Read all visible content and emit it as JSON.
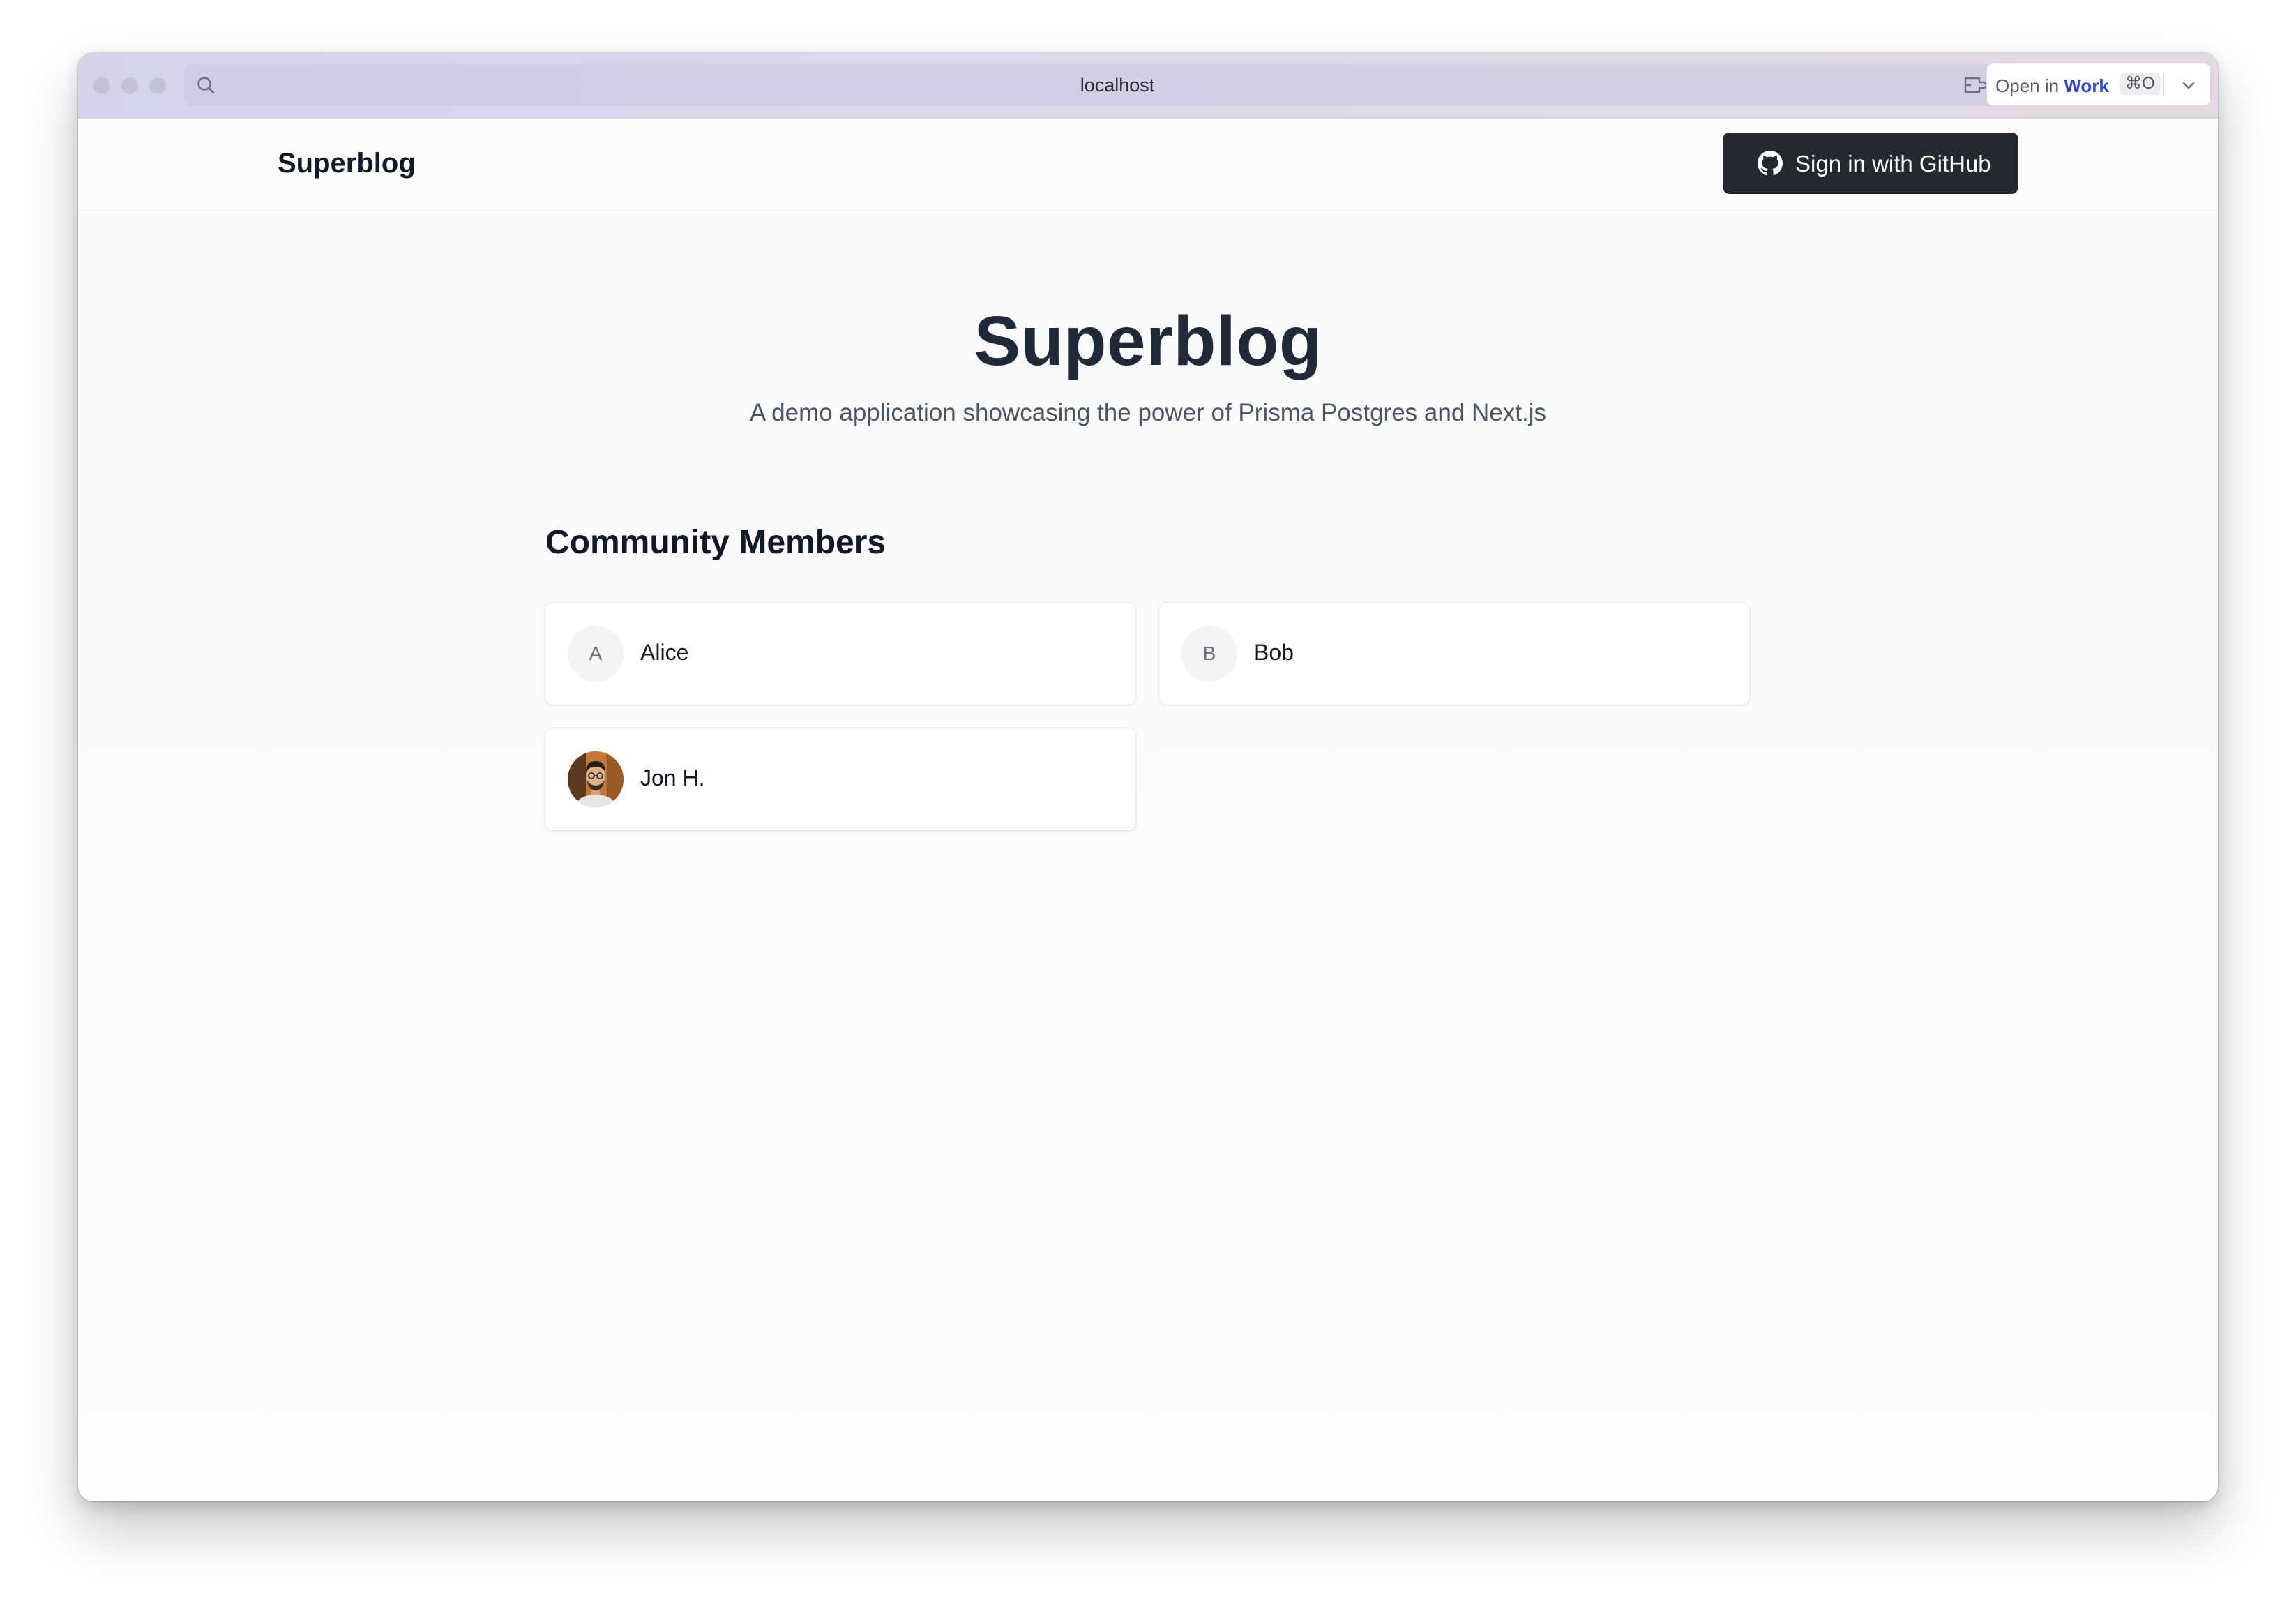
{
  "browser": {
    "url": "localhost",
    "open_in_prefix": "Open in",
    "open_in_target": "Work",
    "open_in_shortcut": "⌘O"
  },
  "navbar": {
    "brand": "Superblog",
    "signin_label": "Sign in with GitHub"
  },
  "hero": {
    "title": "Superblog",
    "subtitle": "A demo application showcasing the power of Prisma Postgres and Next.js"
  },
  "members": {
    "heading": "Community Members",
    "items": [
      {
        "name": "Alice",
        "initial": "A",
        "avatar": "initial"
      },
      {
        "name": "Bob",
        "initial": "B",
        "avatar": "initial"
      },
      {
        "name": "Jon H.",
        "initial": "",
        "avatar": "photo"
      }
    ]
  },
  "colors": {
    "accent_link": "#2f47c4",
    "button_dark": "#24292f",
    "heading": "#1f2937"
  }
}
